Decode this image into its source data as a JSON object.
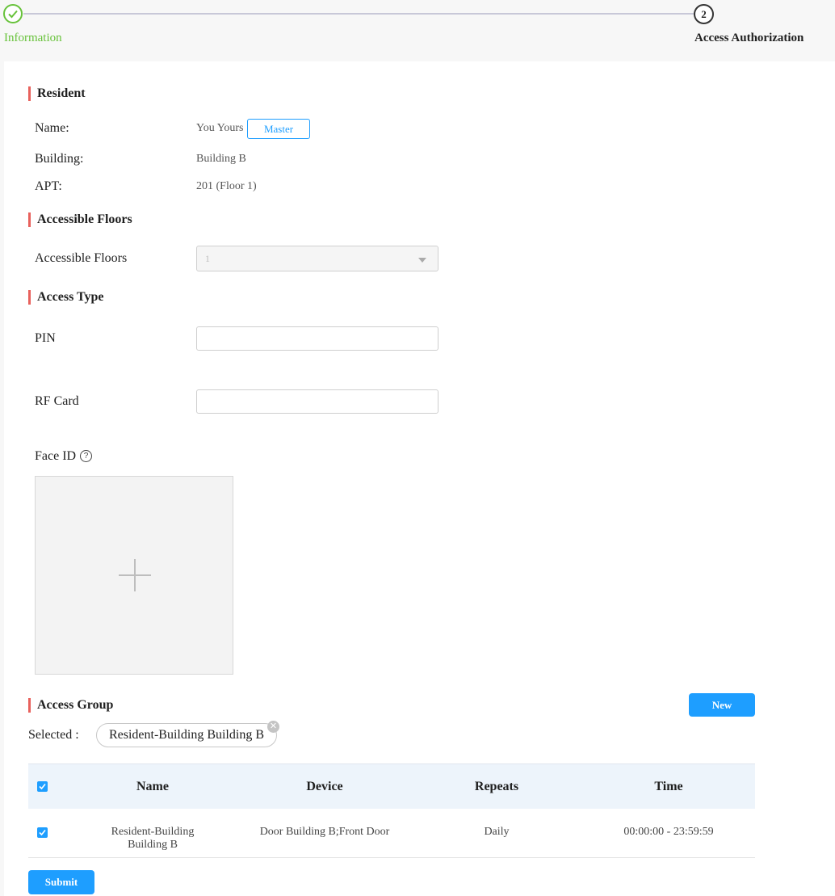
{
  "steps": [
    {
      "number": "1",
      "label": "Information",
      "state": "completed"
    },
    {
      "number": "2",
      "label": "Access Authorization",
      "state": "active"
    }
  ],
  "resident": {
    "title": "Resident",
    "name_label": "Name:",
    "name_value": "You Yours",
    "role_tag": "Master",
    "building_label": "Building:",
    "building_value": "Building B",
    "apt_label": "APT:",
    "apt_value": "201 (Floor 1)"
  },
  "accessible_floors": {
    "title": "Accessible Floors",
    "label": "Accessible Floors",
    "selected": "1"
  },
  "access_type": {
    "title": "Access Type",
    "pin_label": "PIN",
    "pin_value": "",
    "rf_label": "RF Card",
    "rf_value": "",
    "face_label": "Face ID",
    "help_icon": "?"
  },
  "access_group": {
    "title": "Access Group",
    "new_button": "New",
    "selected_label": "Selected :",
    "selected_chip": "Resident-Building Building B",
    "columns": [
      "Name",
      "Device",
      "Repeats",
      "Time"
    ],
    "rows": [
      {
        "checked": true,
        "name": "Resident-Building Building B",
        "device": "Door Building B;Front Door",
        "repeats": "Daily",
        "time": "00:00:00 - 23:59:59"
      }
    ]
  },
  "submit_button": "Submit",
  "colors": {
    "accent": "#1e9eff",
    "success": "#67c23a",
    "section_marker": "#e8615c"
  }
}
